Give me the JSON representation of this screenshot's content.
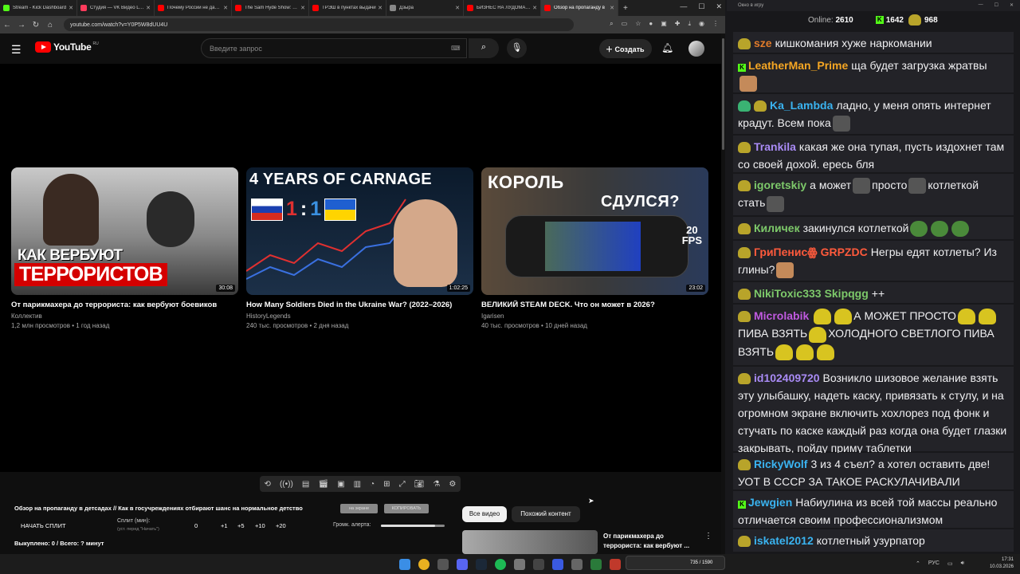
{
  "browser": {
    "tabs": [
      {
        "label": "Stream - Kick Dashboard",
        "color": "#53fc18"
      },
      {
        "label": "Студия — VK Видео Live",
        "color": "#ff3b5c"
      },
      {
        "label": "Почему России не дадут",
        "color": "#ff0000"
      },
      {
        "label": "The Sam Hyde Show: Dea",
        "color": "#ff0000"
      },
      {
        "label": "ТРЭШ в пунктах выдачи",
        "color": "#ff0000"
      },
      {
        "label": "Дзыра",
        "color": "#888888"
      },
      {
        "label": "БИЗНЕС НА ЛУДОМАНАХ",
        "color": "#ff0000"
      },
      {
        "label": "Обзор на пропаганду в",
        "color": "#ff0000"
      }
    ],
    "url": "youtube.com/watch?v=Y0P5W8dUU4U"
  },
  "youtube": {
    "logo_text": "YouTube",
    "logo_region": "RU",
    "search_placeholder": "Введите запрос",
    "create_label": "Создать",
    "videos": [
      {
        "title": "От парикмахера до террориста: как вербуют боевиков",
        "channel": "Коллектив",
        "meta": "1,2 млн просмотров • 1 год назад",
        "duration": "30:08",
        "thumb_line1": "КАК ВЕРБУЮТ",
        "thumb_line2": "ТЕРРОРИСТОВ"
      },
      {
        "title": "How Many Soldiers Died in the Ukraine War? (2022–2026)",
        "channel": "HistoryLegends",
        "meta": "240 тыс. просмотров • 2 дня назад",
        "duration": "1:02:25",
        "thumb_line1": "4 YEARS OF CARNAGE",
        "thumb_score_left": "1",
        "thumb_score_sep": ":",
        "thumb_score_right": "1"
      },
      {
        "title": "ВЕЛИКИЙ STEAM DECK. Что он может в 2026?",
        "channel": "Igarisen",
        "meta": "40 тыс. просмотров • 10 дней назад",
        "duration": "23:02",
        "thumb_line1": "КОРОЛЬ",
        "thumb_line2": "СДУЛСЯ?",
        "thumb_fps_num": "20",
        "thumb_fps_unit": "FPS"
      }
    ]
  },
  "extension": {
    "title": "Обзор на пропаганду в детсадах // Как в госучреждениях отбирают шанс на нормальное детство",
    "chip1": "на экране",
    "chip2": "КОПИРОВАТЬ",
    "start_split": "НАЧАТЬ СПЛИТ",
    "split_label": "Сплит (мин):",
    "split_hint": "(уст. перед \"Начать\")",
    "split_values": [
      "0",
      "+1",
      "+5",
      "+10",
      "+20"
    ],
    "volume_label": "Громк. алерта:",
    "volume_level": 0.85,
    "paid_out": "Выкуплено: 0 / Всего: ? минут",
    "tab_all": "Все видео",
    "tab_similar": "Похожий контент",
    "mini_title": "От парикмахера до террориста: как вербуют ..."
  },
  "chat": {
    "window_title": "Окно в игру",
    "online_label": "Online:",
    "online_value": "2610",
    "kick_count": "1642",
    "other_count": "968",
    "messages": [
      {
        "user": "sze",
        "color": "#e07b2a",
        "text": "кишкомания хуже наркомании"
      },
      {
        "user": "LeatherMan_Prime",
        "color": "#f5a623",
        "text": "ща будет загрузка жратвы"
      },
      {
        "user": "Ka_Lambda",
        "color": "#3ab3f0",
        "text": "ладно, у меня опять интернет крадут. Всем пока"
      },
      {
        "user": "Trankila",
        "color": "#a98bf5",
        "text": "какая же она тупая, пусть издохнет там со своей дохой. ересь бля"
      },
      {
        "user": "igoretskiy",
        "color": "#7dc96a",
        "text1": "а может",
        "text2": "просто",
        "text3": "котлеткой стать"
      },
      {
        "user": "Киличек",
        "color": "#7dc96a",
        "text": "закинулся котлеткой"
      },
      {
        "user": "ГриПенисꙮ",
        "color": "#ff5a3c",
        "mention": "GRPZDC",
        "text": "Негры едят котлеты? Из глины?"
      },
      {
        "user": "NikiToxic333",
        "color": "#7dc96a",
        "mention": "Skipqgg",
        "text": "++"
      },
      {
        "user": "Microlabik",
        "color": "#c05ae0",
        "text1": "А МОЖЕТ ПРОСТО",
        "text2": "ПИВА ВЗЯТЬ",
        "text3": "ХОЛОДНОГО СВЕТЛОГО ПИВА ВЗЯТЬ"
      },
      {
        "user": "id102409720",
        "color": "#a98bf5",
        "text": "Возникло шизовое желание взять эту улыбашку, надеть каску, привязать к стулу, и на огромном экране включить хохлорез под фонк и стучать по каске каждый раз когда она будет глазки закрывать, пойду приму таблетки"
      },
      {
        "user": "RickyWolf",
        "color": "#3ab3f0",
        "text": "3 из 4 съел? а хотел оставить две! УОТ В СССР ЗА ТАКОЕ РАСКУЛАЧИВАЛИ"
      },
      {
        "user": "Jewgien",
        "color": "#3ab3f0",
        "text": "Набиулина из всей той массы реально отличается своим профессионализмом"
      },
      {
        "user": "iskatel2012",
        "color": "#3ab3f0",
        "text": "котлетный узурпатор"
      }
    ]
  },
  "taskbar": {
    "lang": "РУС",
    "time": "17:31",
    "date": "10.03.2026",
    "widget": "735 / 1590"
  }
}
